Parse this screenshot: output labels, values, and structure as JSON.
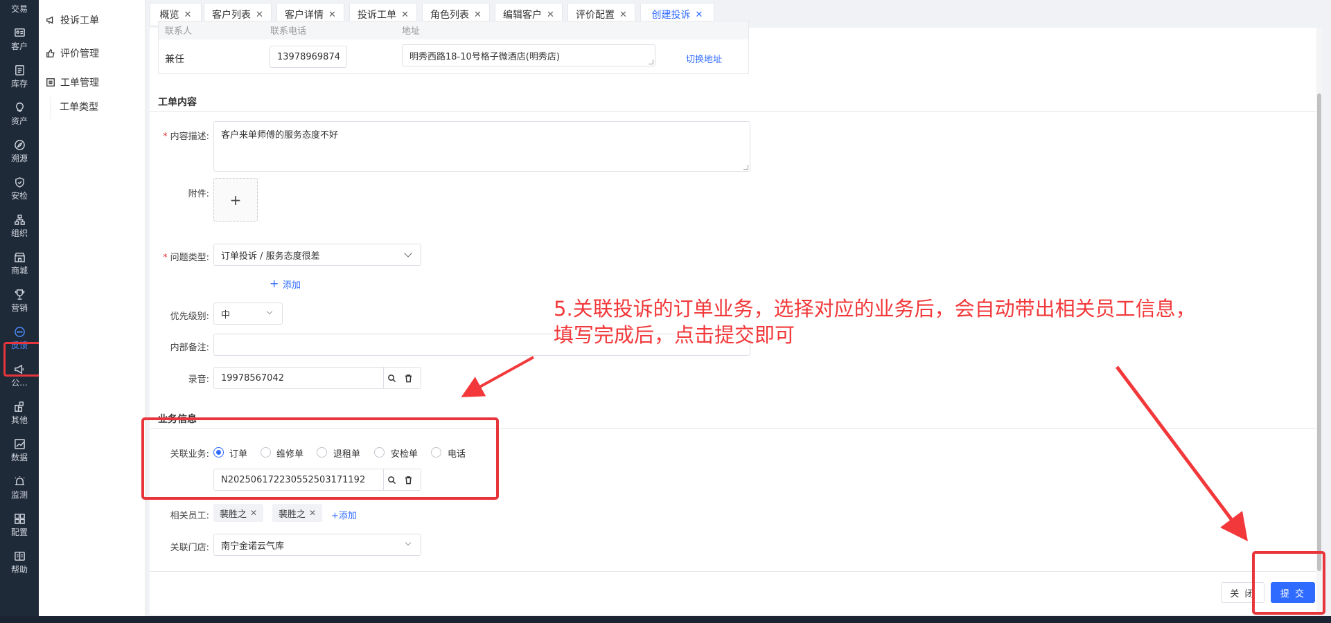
{
  "nav": {
    "items": [
      {
        "label": "交易",
        "icon": "trade-icon"
      },
      {
        "label": "客户",
        "icon": "customer-card-icon"
      },
      {
        "label": "库存",
        "icon": "inventory-icon"
      },
      {
        "label": "资产",
        "icon": "bulb-icon"
      },
      {
        "label": "溯源",
        "icon": "compass-icon"
      },
      {
        "label": "安检",
        "icon": "shield-icon"
      },
      {
        "label": "组织",
        "icon": "org-icon"
      },
      {
        "label": "商城",
        "icon": "store-icon"
      },
      {
        "label": "营销",
        "icon": "trophy-icon"
      },
      {
        "label": "反馈",
        "icon": "chat-icon",
        "active": true
      },
      {
        "label": "公...",
        "icon": "megaphone-icon"
      },
      {
        "label": "其他",
        "icon": "more-icon"
      },
      {
        "label": "数据",
        "icon": "chart-icon"
      },
      {
        "label": "监测",
        "icon": "alarm-icon"
      },
      {
        "label": "配置",
        "icon": "grid-icon"
      },
      {
        "label": "帮助",
        "icon": "book-icon"
      }
    ]
  },
  "subnav": {
    "complaint": "投诉工单",
    "rating": "评价管理",
    "ticket_mgmt": "工单管理",
    "ticket_type": "工单类型"
  },
  "tabs": [
    {
      "label": "概览"
    },
    {
      "label": "客户列表"
    },
    {
      "label": "客户详情"
    },
    {
      "label": "投诉工单"
    },
    {
      "label": "角色列表"
    },
    {
      "label": "编辑客户"
    },
    {
      "label": "评价配置"
    },
    {
      "label": "创建投诉",
      "active": true
    }
  ],
  "contact": {
    "col_contact": "联系人",
    "col_phone": "联系电话",
    "col_address": "地址",
    "name": "兼任",
    "phone": "13978969874",
    "address": "明秀西路18-10号格子微酒店(明秀店)",
    "switch_address": "切换地址"
  },
  "content": {
    "section_title": "工单内容",
    "desc_label": "内容描述:",
    "desc_value": "客户来单师傅的服务态度不好",
    "attach_label": "附件:",
    "issue_label": "问题类型:",
    "issue_value": "订单投诉 / 服务态度很差",
    "add_label": "添加",
    "priority_label": "优先级别:",
    "priority_value": "中",
    "remark_label": "内部备注:",
    "remark_value": "",
    "record_label": "录音:",
    "record_value": "19978567042"
  },
  "business": {
    "section_title": "业务信息",
    "related_label": "关联业务:",
    "options": [
      {
        "label": "订单",
        "checked": true
      },
      {
        "label": "维修单",
        "checked": false
      },
      {
        "label": "退租单",
        "checked": false
      },
      {
        "label": "安检单",
        "checked": false
      },
      {
        "label": "电话",
        "checked": false
      }
    ],
    "order_no": "N202506172230552503171192",
    "staff_label": "相关员工:",
    "staff": [
      "裴胜之",
      "裴胜之"
    ],
    "staff_add": "+添加",
    "store_label": "关联门店:",
    "store_value": "南宁金诺云气库"
  },
  "annotation": {
    "line1": "5.关联投诉的订单业务，选择对应的业务后，会自动带出相关员工信息，",
    "line2": "填写完成后，点击提交即可"
  },
  "footer": {
    "close_label": "关 闭",
    "submit_label": "提 交"
  },
  "colors": {
    "primary": "#2f6bff",
    "annotation_red": "#f2383a",
    "sidebar_bg": "#1f2a38"
  }
}
